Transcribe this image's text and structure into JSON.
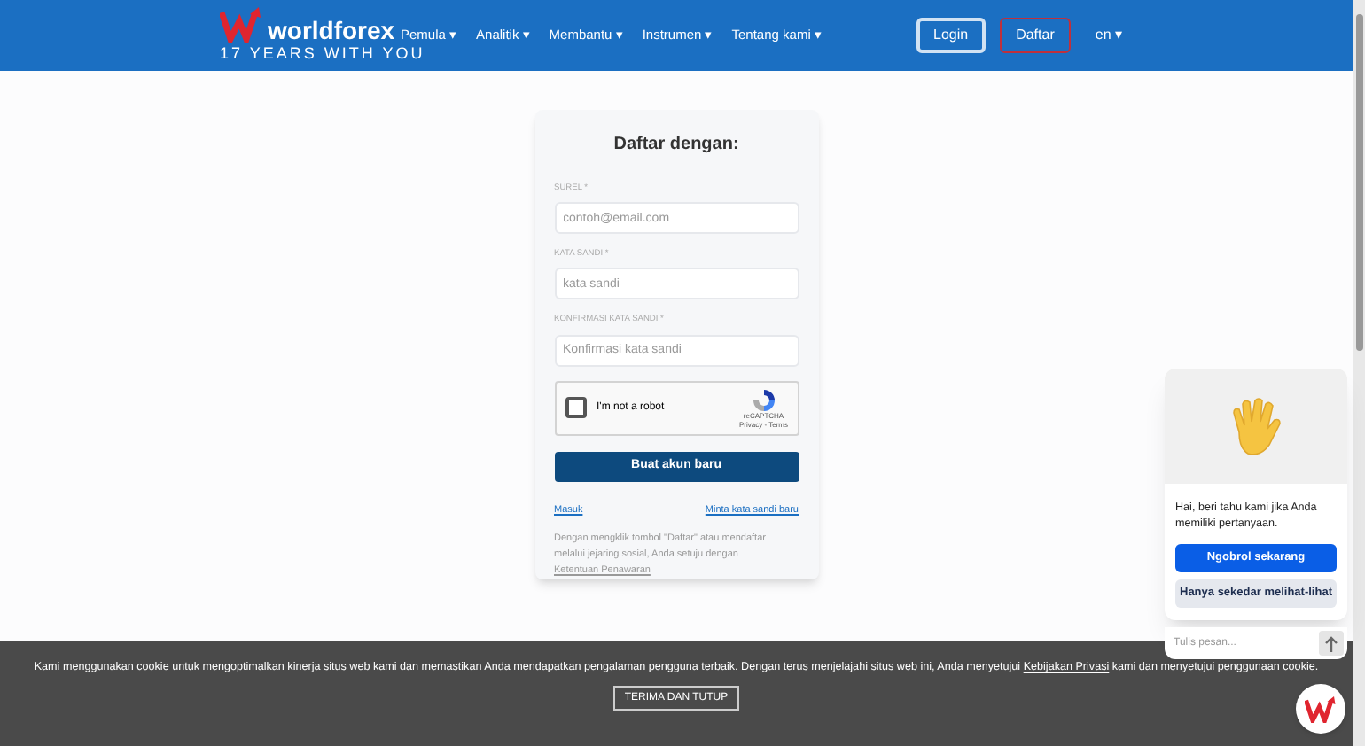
{
  "header": {
    "brand": "worldforex",
    "tagline": "17 YEARS WITH YOU",
    "nav": [
      {
        "label": "Pemula",
        "caret": "▾"
      },
      {
        "label": "Analitik",
        "caret": "▾"
      },
      {
        "label": "Membantu",
        "caret": "▾"
      },
      {
        "label": "Instrumen",
        "caret": "▾"
      },
      {
        "label": "Tentang kami",
        "caret": "▾"
      }
    ],
    "login": "Login",
    "register": "Daftar",
    "language": "en",
    "language_caret": "▾"
  },
  "form": {
    "title": "Daftar dengan:",
    "fields": [
      {
        "label": "SUREL *",
        "placeholder": "contoh@email.com"
      },
      {
        "label": "KATA SANDI *",
        "placeholder": "kata sandi"
      },
      {
        "label": "KONFIRMASI KATA SANDI *",
        "placeholder": "Konfirmasi kata sandi"
      }
    ],
    "captcha": {
      "label": "I'm not a robot",
      "checked": false,
      "brand": "reCAPTCHA",
      "links": "Privacy - Terms"
    },
    "submit": "Buat akun baru",
    "links": [
      "Masuk",
      "Minta kata sandi baru"
    ],
    "terms": "Dengan mengklik tombol \"Daftar\" atau mendaftar melalui jejaring sosial, Anda setuju dengan",
    "terms_link": "Ketentuan Penawaran"
  },
  "chat": {
    "message": "Hai, beri tahu kami jika Anda memiliki pertanyaan.",
    "primary": "Ngobrol sekarang",
    "secondary": "Hanya sekedar melihat-lihat",
    "placeholder": "Tulis pesan..."
  },
  "cookie": {
    "text": "Kami menggunakan cookie untuk mengoptimalkan kinerja situs web kami dan memastikan Anda mendapatkan pengalaman pengguna terbaik. Dengan terus menjelajahi situs web ini, Anda menyetujui",
    "link": "Kebijakan Privasi",
    "text_after": "kami dan menyetujui penggunaan cookie.",
    "button": "TERIMA DAN TUTUP"
  }
}
